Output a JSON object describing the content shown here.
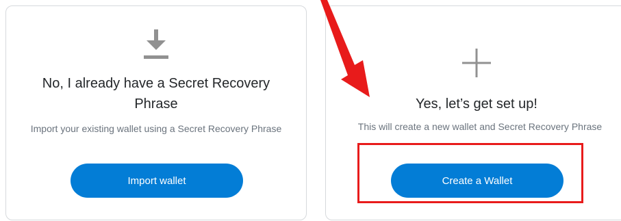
{
  "import_card": {
    "icon": "download-icon",
    "title": "No, I already have a Secret Recovery Phrase",
    "description": "Import your existing wallet using a Secret Recovery Phrase",
    "button_label": "Import wallet"
  },
  "create_card": {
    "icon": "plus-icon",
    "title": "Yes, let’s get set up!",
    "description": "This will create a new wallet and Secret Recovery Phrase",
    "button_label": "Create a Wallet"
  },
  "annotations": {
    "arrow_color": "#e81b1b",
    "highlight_color": "#e81b1b",
    "arrow_icon": "red-arrow-icon"
  },
  "colors": {
    "primary_button": "#037dd6",
    "title_text": "#24272a",
    "description_text": "#6a737d",
    "card_border": "#d6d9dc",
    "icon_gray": "#919191"
  }
}
